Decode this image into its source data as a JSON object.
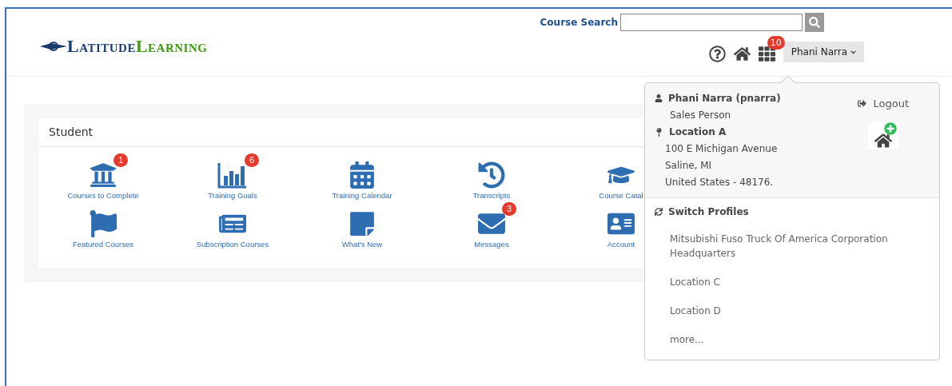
{
  "header": {
    "logo": {
      "first": "Latitude",
      "second": "Learning"
    },
    "search": {
      "label": "Course Search"
    },
    "apps_badge": "10",
    "user_menu": {
      "label": "Phani Narra"
    }
  },
  "panel": {
    "title": "Student",
    "tiles": [
      {
        "label": "Courses to Complete",
        "badge": "1"
      },
      {
        "label": "Training Goals",
        "badge": "6"
      },
      {
        "label": "Training Calendar"
      },
      {
        "label": "Transcripts"
      },
      {
        "label": "Course Catal"
      },
      {
        "label": "Featured Courses"
      },
      {
        "label": "Subscription Courses"
      },
      {
        "label": "What's New"
      },
      {
        "label": "Messages",
        "badge": "3"
      },
      {
        "label": "Account"
      }
    ]
  },
  "dropdown": {
    "user": "Phani Narra (pnarra)",
    "role": "Sales Person",
    "location": "Location A",
    "address": [
      "100 E Michigan Avenue",
      "Saline, MI",
      "United States - 48176."
    ],
    "logout": "Logout",
    "switch_title": "Switch Profiles",
    "profiles": [
      "Mitsubishi Fuso Truck Of America Corporation Headquarters",
      "Location C",
      "Location D"
    ],
    "more": "more..."
  }
}
